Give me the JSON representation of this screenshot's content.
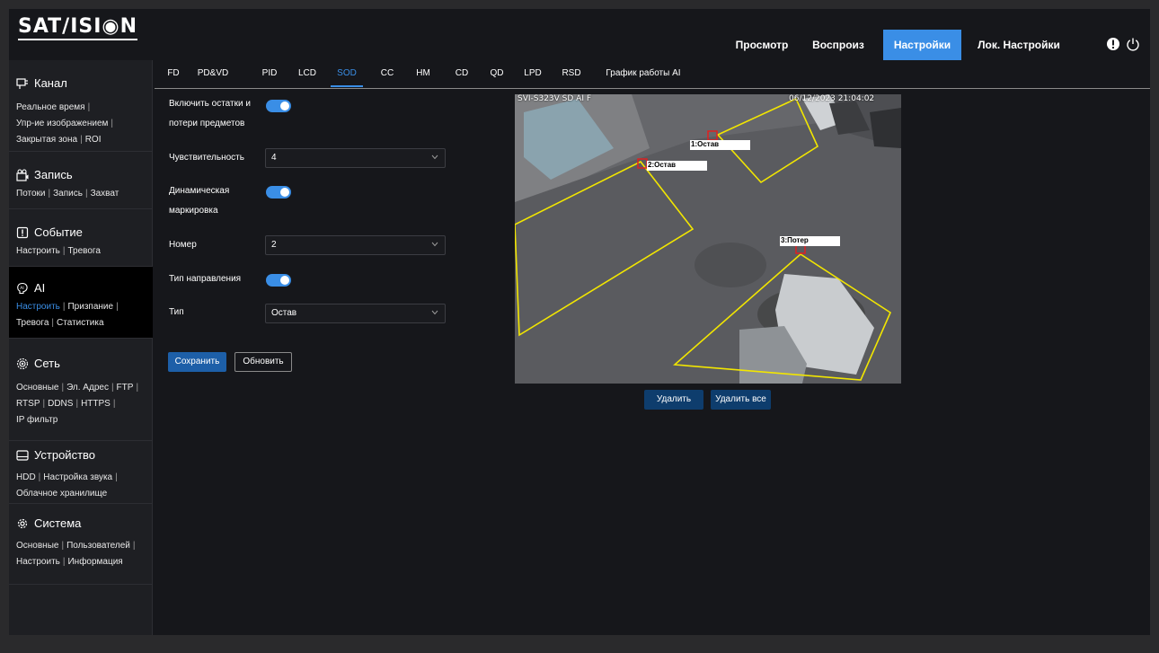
{
  "brand": {
    "logo_text": "SAT/ISI◉N"
  },
  "topnav": [
    {
      "label": "Просмотр",
      "active": false
    },
    {
      "label": "Воспроиз",
      "active": false
    },
    {
      "label": "Настройки",
      "active": true
    },
    {
      "label": "Лок. Настройки",
      "active": false
    }
  ],
  "header_icons": [
    "alert-icon",
    "power-icon"
  ],
  "sidebar": [
    {
      "title": "Канал",
      "icon": "channel-icon",
      "active": false,
      "lines": [
        [
          "Реальное время"
        ],
        [
          "Упр-ие изображением"
        ],
        [
          "Закрытая зона",
          "ROI"
        ]
      ]
    },
    {
      "title": "Запись",
      "icon": "record-icon",
      "active": false,
      "lines": [
        [
          "Потоки",
          "Запись",
          "Захват"
        ]
      ]
    },
    {
      "title": "Событие",
      "icon": "event-icon",
      "active": false,
      "lines": [
        [
          "Настроить",
          "Тревога"
        ]
      ]
    },
    {
      "title": "AI",
      "icon": "ai-icon",
      "active": true,
      "lines": [
        [
          "Настроить",
          "Призпание"
        ],
        [
          "Тревога",
          "Статистика"
        ]
      ]
    },
    {
      "title": "Сеть",
      "icon": "network-icon",
      "active": false,
      "lines": [
        [
          "Основные",
          "Эл. Адрес",
          "FTP"
        ],
        [
          "RTSP",
          "DDNS",
          "HTTPS"
        ],
        [
          "IP фильтр"
        ]
      ]
    },
    {
      "title": "Устройство",
      "icon": "device-icon",
      "active": false,
      "lines": [
        [
          "HDD",
          "Настройка звука"
        ],
        [
          "Облачное хранилище"
        ]
      ]
    },
    {
      "title": "Система",
      "icon": "gear-icon",
      "active": false,
      "lines": [
        [
          "Основные",
          "Пользователей"
        ],
        [
          "Настроить",
          "Информация"
        ]
      ]
    }
  ],
  "tabs": [
    "FD",
    "PD&VD",
    "PID",
    "LCD",
    "SOD",
    "CC",
    "HM",
    "CD",
    "QD",
    "LPD",
    "RSD",
    "График работы AI"
  ],
  "active_tab": "SOD",
  "form": {
    "enable_label_1": "Включить остатки и",
    "enable_label_2": "потери предметов",
    "enable_on": true,
    "sensitivity_label": "Чувствительность",
    "sensitivity_value": "4",
    "dynamic_label_1": "Динамическая",
    "dynamic_label_2": "маркировка",
    "dynamic_on": true,
    "number_label": "Номер",
    "number_value": "2",
    "direction_label": "Тип направления",
    "direction_on": true,
    "type_label": "Тип",
    "type_value": "Остав"
  },
  "buttons": {
    "save": "Сохранить",
    "refresh": "Обновить",
    "delete": "Удалить",
    "delete_all": "Удалить все"
  },
  "video": {
    "camera_name": "SVI-S323V SD AI F",
    "timestamp": "06/12/2023 21:04:02",
    "zones": [
      "1:Остав",
      "2:Остав",
      "3:Потер"
    ]
  },
  "colors": {
    "accent": "#3a8ee6",
    "zone": "#f2e600",
    "marker": "#e02020"
  }
}
